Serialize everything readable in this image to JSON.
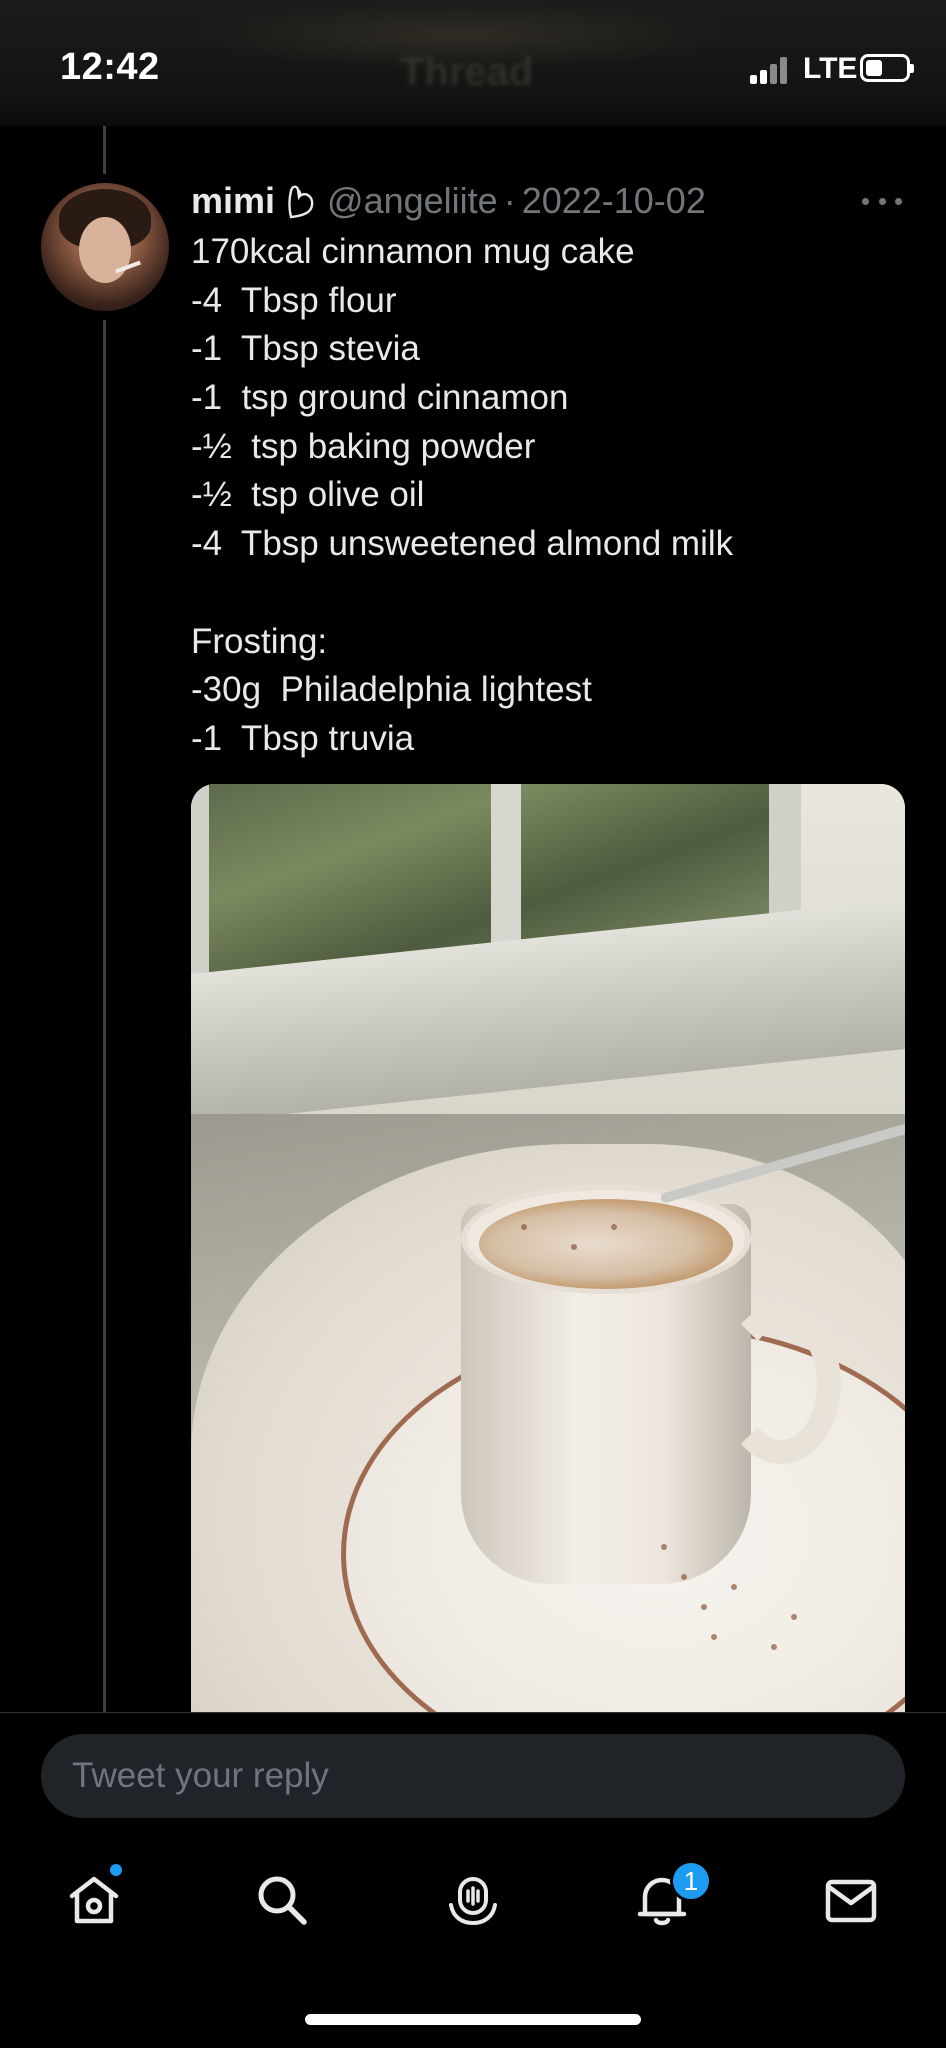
{
  "status_bar": {
    "time": "12:42",
    "network": "LTE",
    "header_title_faded": "Thread"
  },
  "tweet": {
    "author_name": "mimi",
    "author_emoji": "flexed-biceps-outline",
    "handle": "@angeliite",
    "separator": "·",
    "date": "2022-10-02",
    "lines": [
      "170kcal cinnamon mug cake",
      "-4  Tbsp flour",
      "-1  Tbsp stevia",
      "-1  tsp ground cinnamon",
      "-½  tsp baking powder",
      "-½  tsp olive oil",
      "-4  Tbsp unsweetened almond milk",
      "",
      "Frosting:",
      "-30g  Philadelphia lightest",
      "-1  Tbsp truvia"
    ],
    "more_icon": "ellipsis-icon",
    "photo_icon": "photo-mug-cake"
  },
  "reply": {
    "placeholder": "Tweet your reply"
  },
  "tabbar": {
    "items": [
      {
        "name": "home",
        "icon": "home-icon"
      },
      {
        "name": "search",
        "icon": "search-icon"
      },
      {
        "name": "spaces",
        "icon": "spaces-icon"
      },
      {
        "name": "notifications",
        "icon": "bell-icon"
      },
      {
        "name": "messages",
        "icon": "mail-icon"
      }
    ],
    "notifications_count": "1"
  },
  "colors": {
    "background": "#000000",
    "text": "#e7e9ea",
    "muted": "#71767b",
    "accent": "#1d9bf0",
    "input_bg": "#202327"
  }
}
